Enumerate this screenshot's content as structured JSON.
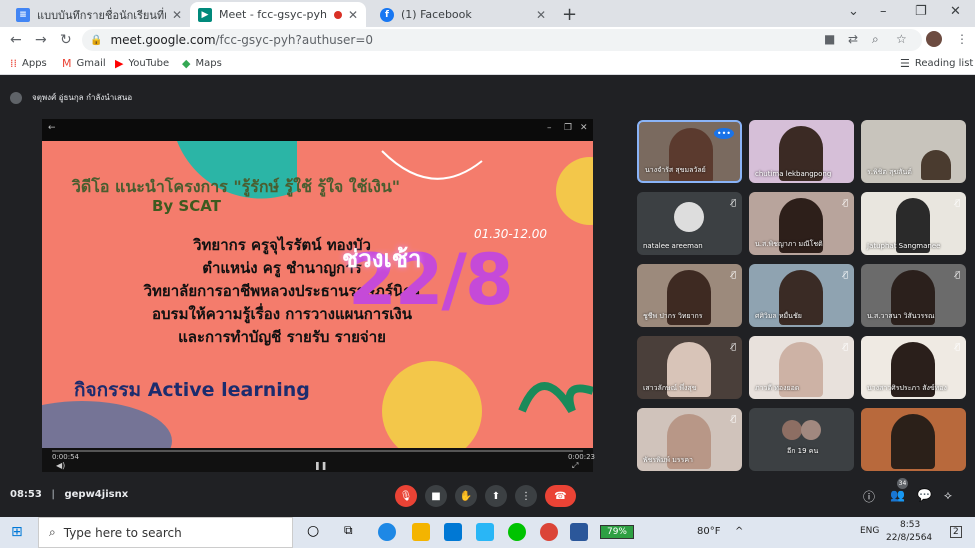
{
  "browser": {
    "tabs": [
      {
        "title": "แบบบันทึกรายชื่อนักเรียนที่เข้าร่วมอบรม",
        "favicon": "doc-icon"
      },
      {
        "title": "Meet - fcc-gsyc-pyh",
        "favicon": "meet-icon"
      },
      {
        "title": "(1) Facebook",
        "favicon": "facebook-icon"
      }
    ],
    "url_host": "meet.google.com",
    "url_path": "/fcc-gsyc-pyh?authuser=0",
    "bookmarks": [
      {
        "label": "Apps",
        "icon": "apps-grid-icon"
      },
      {
        "label": "Gmail",
        "icon": "gmail-icon"
      },
      {
        "label": "YouTube",
        "icon": "youtube-icon"
      },
      {
        "label": "Maps",
        "icon": "maps-icon"
      }
    ],
    "reading_list": "Reading list"
  },
  "meet": {
    "presenter_label": "จตุพงศ์ อู่ธนกุล กำลังนำเสนอ",
    "slide": {
      "title": "วิดีโอ แนะนำโครงการ \"รู้รักษ์ รู้ใช้ รู้ใจ ใช้เงิน\"",
      "by": "By SCAT",
      "lines": [
        "วิทยากร ครูจุไรรัตน์  ทองบัว",
        "ตำแหน่ง ครู ชำนาญการ",
        "วิทยาลัยการอาชีพหลวงประธานราษฎร์นิกร",
        "อบรมให้ความรู้เรื่อง การวางแผนการเงิน",
        "และการทำบัญชี รายรับ รายจ่าย"
      ],
      "activity": "กิจกรรม Active learning",
      "morning": "ช่วงเช้า",
      "date": "22/8",
      "time": "01.30-12.00",
      "elapsed": "0:00:54",
      "remaining": "0:00:23"
    },
    "participants": [
      {
        "name": "นางจำรัส สุขมลวัลย์",
        "muted": false
      },
      {
        "name": "chutima lekbangpong",
        "muted": false
      },
      {
        "name": "ร.พิชิต สุขสันต์",
        "muted": false
      },
      {
        "name": "natalee areeman",
        "muted": true
      },
      {
        "name": "น.ส.พิชญาภา มณีโชติ",
        "muted": true
      },
      {
        "name": "Jatuphat Sangmanee",
        "muted": true
      },
      {
        "name": "ชูชีพ ปากร วิทยากร",
        "muted": true
      },
      {
        "name": "ศศิวิมล หมื่นชัย",
        "muted": true
      },
      {
        "name": "น.ส.วาสนา วิสันวรรณ",
        "muted": true
      },
      {
        "name": "เสาวลักษณ์ พึ่งสุข",
        "muted": true
      },
      {
        "name": "ภาวดี ทองยอด",
        "muted": true
      },
      {
        "name": "นางสาวศิรประภา สังข์ทอง",
        "muted": true
      },
      {
        "name": "พัชรพิมพ์ มรรคา",
        "muted": true
      },
      {
        "name": "อีก 19 คน",
        "muted": false
      },
      {
        "name": "",
        "muted": false
      }
    ],
    "time": "08:53",
    "meeting_code": "gepw4jisnx",
    "people_count": "34"
  },
  "taskbar": {
    "search_placeholder": "Type here to search",
    "battery": "79%",
    "temperature": "80°F",
    "language": "ENG",
    "clock_time": "8:53",
    "clock_date": "22/8/2564",
    "notifications": "2"
  }
}
